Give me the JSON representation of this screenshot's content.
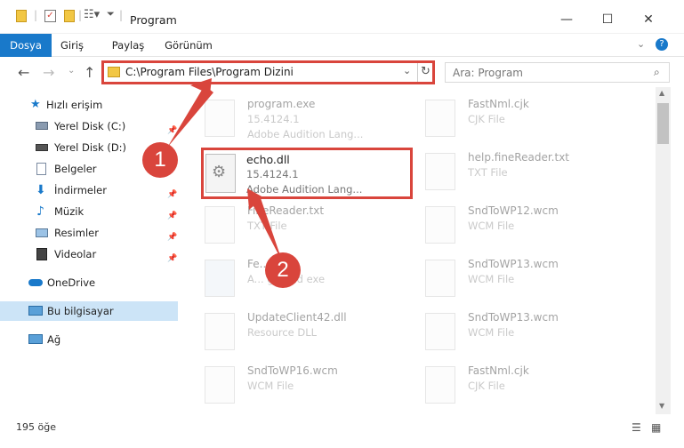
{
  "window": {
    "title": "Program",
    "minimize": "—",
    "maximize": "☐",
    "close": "✕"
  },
  "ribbon": {
    "tabs": [
      "Dosya",
      "Giriş",
      "Paylaş",
      "Görünüm"
    ]
  },
  "address": {
    "path": "C:\\Program Files\\Program Dizini"
  },
  "search": {
    "placeholder": "Ara: Program"
  },
  "sidebar": {
    "items": [
      {
        "label": "Hızlı erişim"
      },
      {
        "label": "Yerel Disk (C:)"
      },
      {
        "label": "Yerel Disk (D:)"
      },
      {
        "label": "Belgeler"
      },
      {
        "label": "İndirmeler"
      },
      {
        "label": "Müzik"
      },
      {
        "label": "Resimler"
      },
      {
        "label": "Videolar"
      },
      {
        "label": "OneDrive"
      },
      {
        "label": "Bu bilgisayar"
      },
      {
        "label": "Ağ"
      }
    ]
  },
  "files": {
    "col1": [
      {
        "name": "program.exe",
        "version": "15.4124.1",
        "desc": "Adobe Audition Lang..."
      },
      {
        "name": "echo.dll",
        "version": "15.4124.1",
        "desc": "Adobe Audition Lang..."
      },
      {
        "name": "FineReader.txt",
        "version": "TXT File",
        "desc": ""
      },
      {
        "name": "Fe...exe",
        "version": "A... ground exe",
        "desc": ""
      },
      {
        "name": "UpdateClient42.dll",
        "version": "Resource DLL",
        "desc": ""
      },
      {
        "name": "SndToWP16.wcm",
        "version": "WCM File",
        "desc": ""
      }
    ],
    "col2": [
      {
        "name": "FastNml.cjk",
        "version": "CJK File"
      },
      {
        "name": "help.fineReader.txt",
        "version": "TXT File"
      },
      {
        "name": "SndToWP12.wcm",
        "version": "WCM File"
      },
      {
        "name": "SndToWP13.wcm",
        "version": "WCM File"
      },
      {
        "name": "SndToWP13.wcm",
        "version": "WCM File"
      },
      {
        "name": "FastNml.cjk",
        "version": "CJK File"
      }
    ]
  },
  "status": {
    "count": "195 öğe"
  },
  "callouts": {
    "one": "1",
    "two": "2"
  },
  "colors": {
    "accent": "#1979ca",
    "callout": "#d9453c",
    "selection": "#cce4f7"
  }
}
